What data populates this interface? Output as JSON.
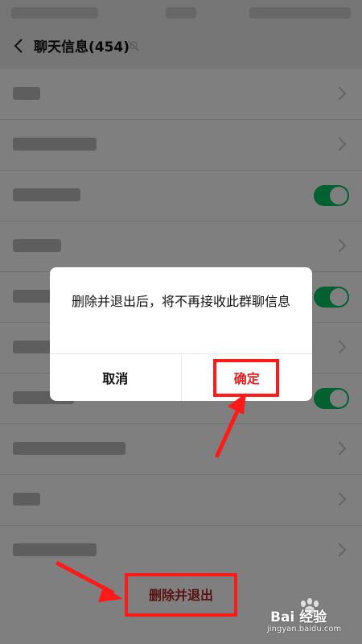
{
  "header": {
    "title": "聊天信息(454)"
  },
  "dialog": {
    "message": "删除并退出后，将不再接收此群聊信息",
    "cancel_label": "取消",
    "confirm_label": "确定"
  },
  "footer": {
    "exit_label": "删除并退出"
  },
  "watermark": {
    "brand": "Bai 经验",
    "url": "jingyan.baidu.com"
  },
  "colors": {
    "annotation_red": "#ff1a1a",
    "confirm_text": "#e02020",
    "toggle_green": "#07c160"
  }
}
